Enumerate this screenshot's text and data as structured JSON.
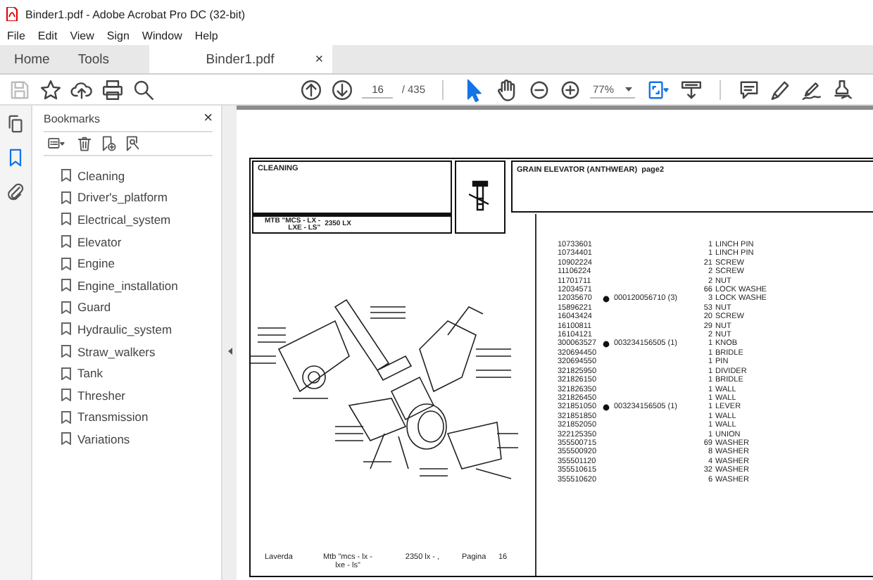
{
  "window": {
    "title": "Binder1.pdf - Adobe Acrobat Pro DC (32-bit)"
  },
  "menu": [
    "File",
    "Edit",
    "View",
    "Sign",
    "Window",
    "Help"
  ],
  "tabs": [
    {
      "label": "Home",
      "selected": false
    },
    {
      "label": "Tools",
      "selected": false
    },
    {
      "label": "Binder1.pdf",
      "selected": true,
      "close": "×"
    }
  ],
  "toolbar": {
    "save_disabled": true,
    "page_field": "16",
    "page_total": "/ 435",
    "zoom": "77%",
    "tools": [
      {
        "kind": "select",
        "selected": true
      },
      {
        "kind": "hand",
        "selected": false
      }
    ]
  },
  "sidebar_icons": [
    {
      "kind": "pages",
      "selected": false
    },
    {
      "kind": "bookmarks",
      "selected": true
    },
    {
      "kind": "attachments",
      "selected": false
    }
  ],
  "bookmarks": {
    "title": "Bookmarks",
    "close": "×",
    "items": [
      "Cleaning",
      "Driver's_platform",
      "Electrical_system",
      "Elevator",
      "Engine",
      "Engine_installation",
      "Guard",
      "Hydraulic_system",
      "Straw_walkers",
      "Tank",
      "Thresher",
      "Transmission",
      "Variations"
    ]
  },
  "document": {
    "group_title": "CLEANING",
    "model_lines": [
      "MTB \"MCS - LX -",
      "LXE - LS\""
    ],
    "model_code": "2350 LX",
    "section_title": "GRAIN ELEVATOR (ANTHWEAR)  page2",
    "parts": [
      {
        "code": "10733601",
        "qty": "1",
        "desc": "LINCH PIN"
      },
      {
        "code": "10734401",
        "qty": "1",
        "desc": "LINCH PIN"
      },
      {
        "code": "10902224",
        "qty": "21",
        "desc": "SCREW"
      },
      {
        "code": "11106224",
        "qty": "2",
        "desc": "SCREW"
      },
      {
        "code": "11701711",
        "qty": "2",
        "desc": "NUT"
      },
      {
        "code": "12034571",
        "qty": "66",
        "desc": "LOCK WASHE"
      },
      {
        "code": "12035670",
        "ref": "000120056710  (3)",
        "qty": "3",
        "desc": "LOCK WASHE"
      },
      {
        "code": "15896221",
        "qty": "53",
        "desc": "NUT"
      },
      {
        "code": "16043424",
        "qty": "20",
        "desc": "SCREW"
      },
      {
        "code": "16100811",
        "qty": "29",
        "desc": "NUT"
      },
      {
        "code": "16104121",
        "qty": "2",
        "desc": "NUT"
      },
      {
        "code": "300063527",
        "ref": "003234156505  (1)",
        "qty": "1",
        "desc": "KNOB"
      },
      {
        "code": "320694450",
        "qty": "1",
        "desc": "BRIDLE"
      },
      {
        "code": "320694550",
        "qty": "1",
        "desc": "PIN"
      },
      {
        "code": "321825950",
        "qty": "1",
        "desc": "DIVIDER"
      },
      {
        "code": "321826150",
        "qty": "1",
        "desc": "BRIDLE"
      },
      {
        "code": "321826350",
        "qty": "1",
        "desc": "WALL"
      },
      {
        "code": "321826450",
        "qty": "1",
        "desc": "WALL"
      },
      {
        "code": "321851050",
        "ref": "003234156505  (1)",
        "qty": "1",
        "desc": "LEVER"
      },
      {
        "code": "321851850",
        "qty": "1",
        "desc": "WALL"
      },
      {
        "code": "321852050",
        "qty": "1",
        "desc": "WALL"
      },
      {
        "code": "322125350",
        "qty": "1",
        "desc": "UNION"
      },
      {
        "code": "355500715",
        "qty": "69",
        "desc": "WASHER"
      },
      {
        "code": "355500920",
        "qty": "8",
        "desc": "WASHER"
      },
      {
        "code": "355501120",
        "qty": "4",
        "desc": "WASHER"
      },
      {
        "code": "355510615",
        "qty": "32",
        "desc": "WASHER"
      },
      {
        "code": "355510620",
        "qty": "6",
        "desc": "WASHER"
      }
    ],
    "footer": {
      "brand": "Laverda",
      "model_lines": [
        "Mtb \"mcs - lx -",
        "lxe - ls\""
      ],
      "code": "2350 lx - ,",
      "page_label": "Pagina",
      "page_number": "16"
    }
  }
}
